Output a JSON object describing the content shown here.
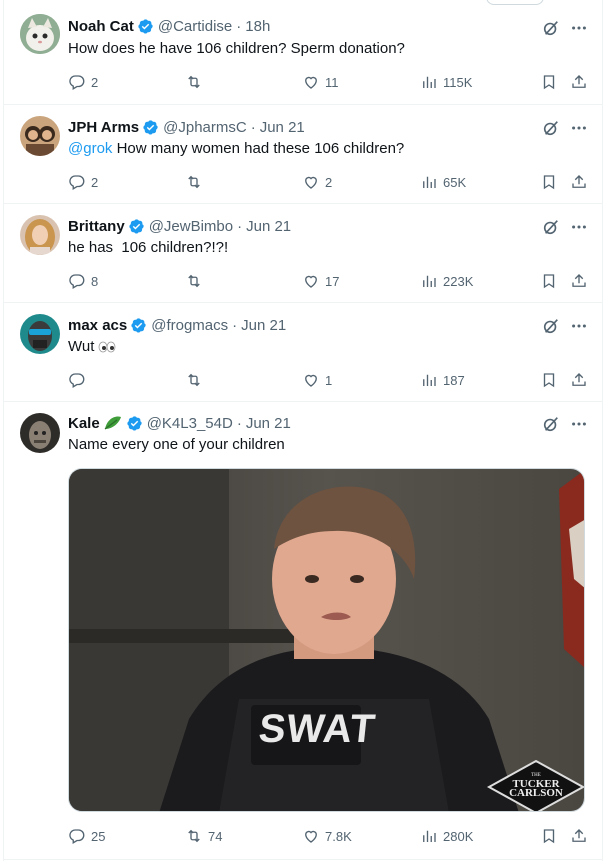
{
  "tweets": [
    {
      "name": "Noah Cat",
      "handle": "@Cartidise",
      "time": "18h",
      "text": "How does he have 106 children? Sperm donation?",
      "replies": "2",
      "reposts": "",
      "likes": "11",
      "views": "115K"
    },
    {
      "name": "JPH Arms",
      "handle": "@JpharmsC",
      "time": "Jun 21",
      "mention": "@grok",
      "text": " How many women had these 106 children?",
      "replies": "2",
      "reposts": "",
      "likes": "2",
      "views": "65K"
    },
    {
      "name": "Brittany",
      "handle": "@JewBimbo",
      "time": "Jun 21",
      "text": "he has  106 children?!?!",
      "replies": "8",
      "reposts": "",
      "likes": "17",
      "views": "223K"
    },
    {
      "name": "max acs",
      "handle": "@frogmacs",
      "time": "Jun 21",
      "text": "Wut",
      "replies": "",
      "reposts": "",
      "likes": "1",
      "views": "187"
    },
    {
      "name": "Kale",
      "handle": "@K4L3_54D",
      "time": "Jun 21",
      "text": "Name every one of your children",
      "media_badge": "SWAT",
      "media_logo_small": "THE",
      "media_logo_top": "TUCKER",
      "media_logo_bottom": "CARLSON",
      "replies": "25",
      "reposts": "74",
      "likes": "7.8K",
      "views": "280K"
    }
  ],
  "colors": {
    "accent": "#1d9bf0",
    "text": "#0f1419",
    "muted": "#536471",
    "divider": "#eff3f4"
  }
}
